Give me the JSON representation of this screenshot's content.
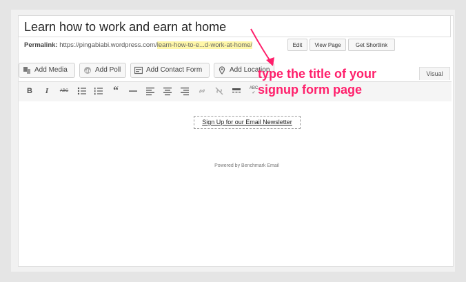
{
  "editor": {
    "title": "Learn how to work and earn at home",
    "permalink": {
      "label": "Permalink:",
      "base": "https://pingabiabi.wordpress.com/",
      "slug": "learn-how-to-e...d-work-at-home/",
      "buttons": {
        "edit": "Edit",
        "view": "View Page",
        "shortlink": "Get Shortlink"
      }
    },
    "media_buttons": {
      "add_media": "Add Media",
      "add_poll": "Add Poll",
      "add_contact_form": "Add Contact Form",
      "add_location": "Add Location"
    },
    "tab_visual": "Visual",
    "content": {
      "signup_link": "Sign Up for our Email Newsletter",
      "powered_by": "Powered by Benchmark Email"
    }
  },
  "annotation": {
    "text": "type the title of your signup form page",
    "color": "#ff1f6b"
  },
  "toolbar_icons": [
    "bold-icon",
    "italic-icon",
    "strikethrough-icon",
    "bullet-list-icon",
    "numbered-list-icon",
    "blockquote-icon",
    "horizontal-rule-icon",
    "align-left-icon",
    "align-center-icon",
    "align-right-icon",
    "link-icon",
    "unlink-icon",
    "read-more-icon",
    "spellcheck-icon"
  ]
}
